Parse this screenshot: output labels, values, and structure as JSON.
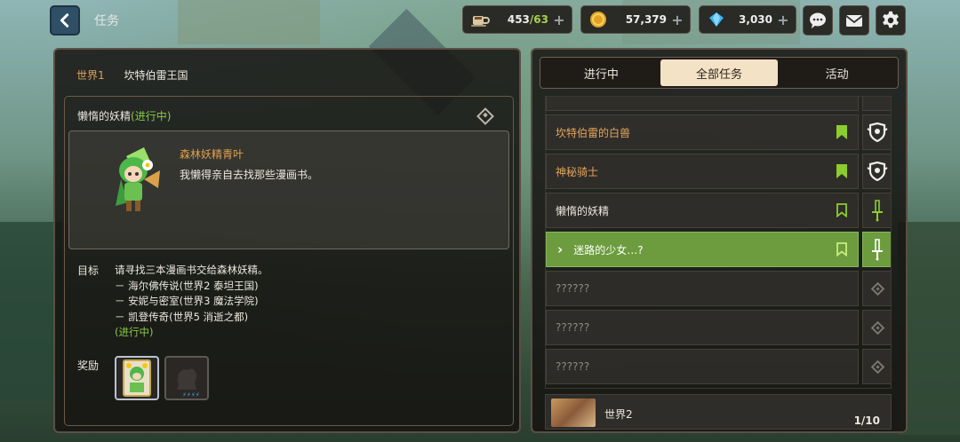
{
  "header": {
    "title": "任务",
    "resources": [
      {
        "name": "stamina",
        "value": "453",
        "max": "/63"
      },
      {
        "name": "meso",
        "value": "57,379"
      },
      {
        "name": "crystal",
        "value": "3,030"
      }
    ],
    "plus": "+"
  },
  "left": {
    "world": "世界1",
    "kingdom": "坎特伯雷王国",
    "quest": {
      "name": "懒惰的妖精",
      "status": "(进行中)",
      "npc_name": "森林妖精青叶",
      "npc_line": "我懒得亲自去找那些漫画书。",
      "goal_label": "目标",
      "goal_main": "请寻找三本漫画书交给森林妖精。",
      "goal_items": [
        "－ 海尔佛传说(世界2  泰坦王国)",
        "－ 安妮与密室(世界3  魔法学院)",
        "－ 凯登传奇(世界5  消逝之都)"
      ],
      "goal_status": "(进行中)",
      "reward_label": "奖励"
    }
  },
  "right": {
    "tabs": [
      "进行中",
      "全部任务",
      "活动"
    ],
    "active_tab": "全部任务",
    "quests": [
      {
        "title": "坎特伯雷的白兽",
        "style": "orange"
      },
      {
        "title": "神秘骑士",
        "style": "orange"
      },
      {
        "title": "懒惰的妖精",
        "style": "white"
      },
      {
        "title": "迷路的少女…?",
        "style": "selected"
      },
      {
        "title": "??????",
        "style": "unknown"
      },
      {
        "title": "??????",
        "style": "unknown"
      },
      {
        "title": "??????",
        "style": "unknown"
      }
    ],
    "world2_label": "世界2",
    "world2_count": "1/10"
  },
  "colors": {
    "accent_green": "#6c9c3e",
    "quest_orange": "#e4a55a",
    "status_green": "#89c946",
    "bookmark_green": "#8ccd2e"
  }
}
